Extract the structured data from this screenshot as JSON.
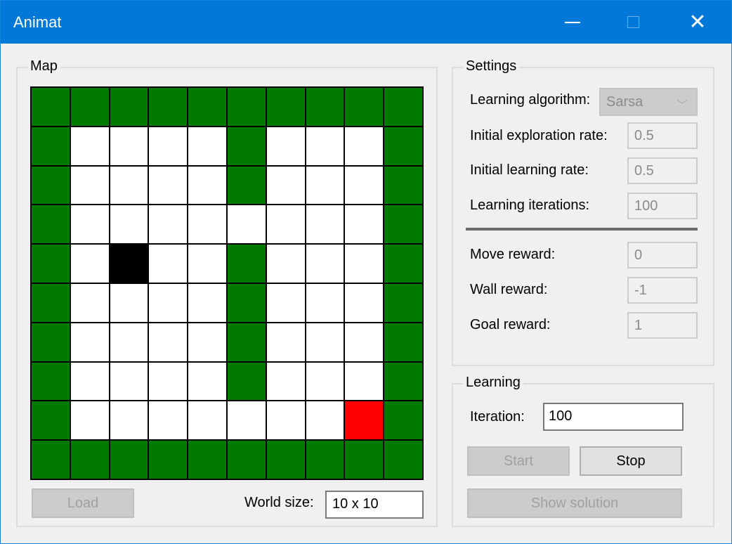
{
  "window": {
    "title": "Animat",
    "minimize_label": "Minimize",
    "maximize_label": "Maximize",
    "close_label": "Close"
  },
  "map": {
    "legend": "Map",
    "colors": {
      "wall": "#007a00",
      "empty": "#ffffff",
      "agent": "#000000",
      "goal": "#ff0000"
    },
    "grid": [
      "WWWWWWWWWW",
      "W....W...W",
      "W....W...W",
      "W........W",
      "W.A..W...W",
      "W....W...W",
      "W....W...W",
      "W....W...W",
      "W.......GW",
      "WWWWWWWWWW"
    ],
    "load_button": {
      "label": "Load",
      "enabled": false
    },
    "world_size_label": "World size:",
    "world_size_value": "10 x 10"
  },
  "settings": {
    "legend": "Settings",
    "learning_algorithm": {
      "label": "Learning algorithm:",
      "value": "Sarsa",
      "enabled": false
    },
    "initial_exploration_rate": {
      "label": "Initial exploration rate:",
      "value": "0.5"
    },
    "initial_learning_rate": {
      "label": "Initial learning rate:",
      "value": "0.5"
    },
    "learning_iterations": {
      "label": "Learning iterations:",
      "value": "100"
    },
    "move_reward": {
      "label": "Move reward:",
      "value": "0"
    },
    "wall_reward": {
      "label": "Wall reward:",
      "value": "-1"
    },
    "goal_reward": {
      "label": "Goal reward:",
      "value": "1"
    }
  },
  "learning": {
    "legend": "Learning",
    "iteration_label": "Iteration:",
    "iteration_value": "100",
    "start_button": {
      "label": "Start",
      "enabled": false
    },
    "stop_button": {
      "label": "Stop",
      "enabled": true
    },
    "show_solution_button": {
      "label": "Show solution",
      "enabled": false
    }
  }
}
